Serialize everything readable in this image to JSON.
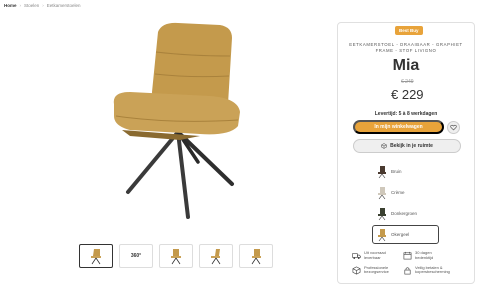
{
  "breadcrumb": [
    "Home",
    "Stoelen",
    "Eetkamerstoelen"
  ],
  "product": {
    "badge": "Best Buy",
    "subtitle": "EETKAMERSTOEL - DRAAIBAAR - GRAPHIET FRAME - STOF LIVIGNO",
    "name": "Mia",
    "old_price": "€ 249",
    "price": "€ 229",
    "delivery": "Levertijd: 5 à 8 werkdagen"
  },
  "actions": {
    "cart_label": "In mijn winkelwagen",
    "room_label": "Bekijk in je ruimte"
  },
  "swatches": [
    {
      "label": "Bruin",
      "color": "#4a3a30"
    },
    {
      "label": "Crème",
      "color": "#cfc8bb"
    },
    {
      "label": "Donkergroen",
      "color": "#3a4030"
    },
    {
      "label": "Okergeel",
      "color": "#c49a4c",
      "selected": true
    }
  ],
  "thumbnails": [
    {
      "kind": "image",
      "active": true
    },
    {
      "kind": "360",
      "label": "360°"
    },
    {
      "kind": "image"
    },
    {
      "kind": "image"
    },
    {
      "kind": "image"
    }
  ],
  "usps": [
    {
      "icon": "truck-icon",
      "text": "Uit voorraad leverbaar"
    },
    {
      "icon": "calendar-icon",
      "text": "30 dagen bedenktijd"
    },
    {
      "icon": "box-icon",
      "text": "Professionele bezorgservice"
    },
    {
      "icon": "lock-icon",
      "text": "Veilig betalen & kopersbescherming"
    }
  ],
  "colors": {
    "accent": "#e8a33a",
    "fabric": "#c49a4c",
    "frame": "#3a3a3a"
  }
}
